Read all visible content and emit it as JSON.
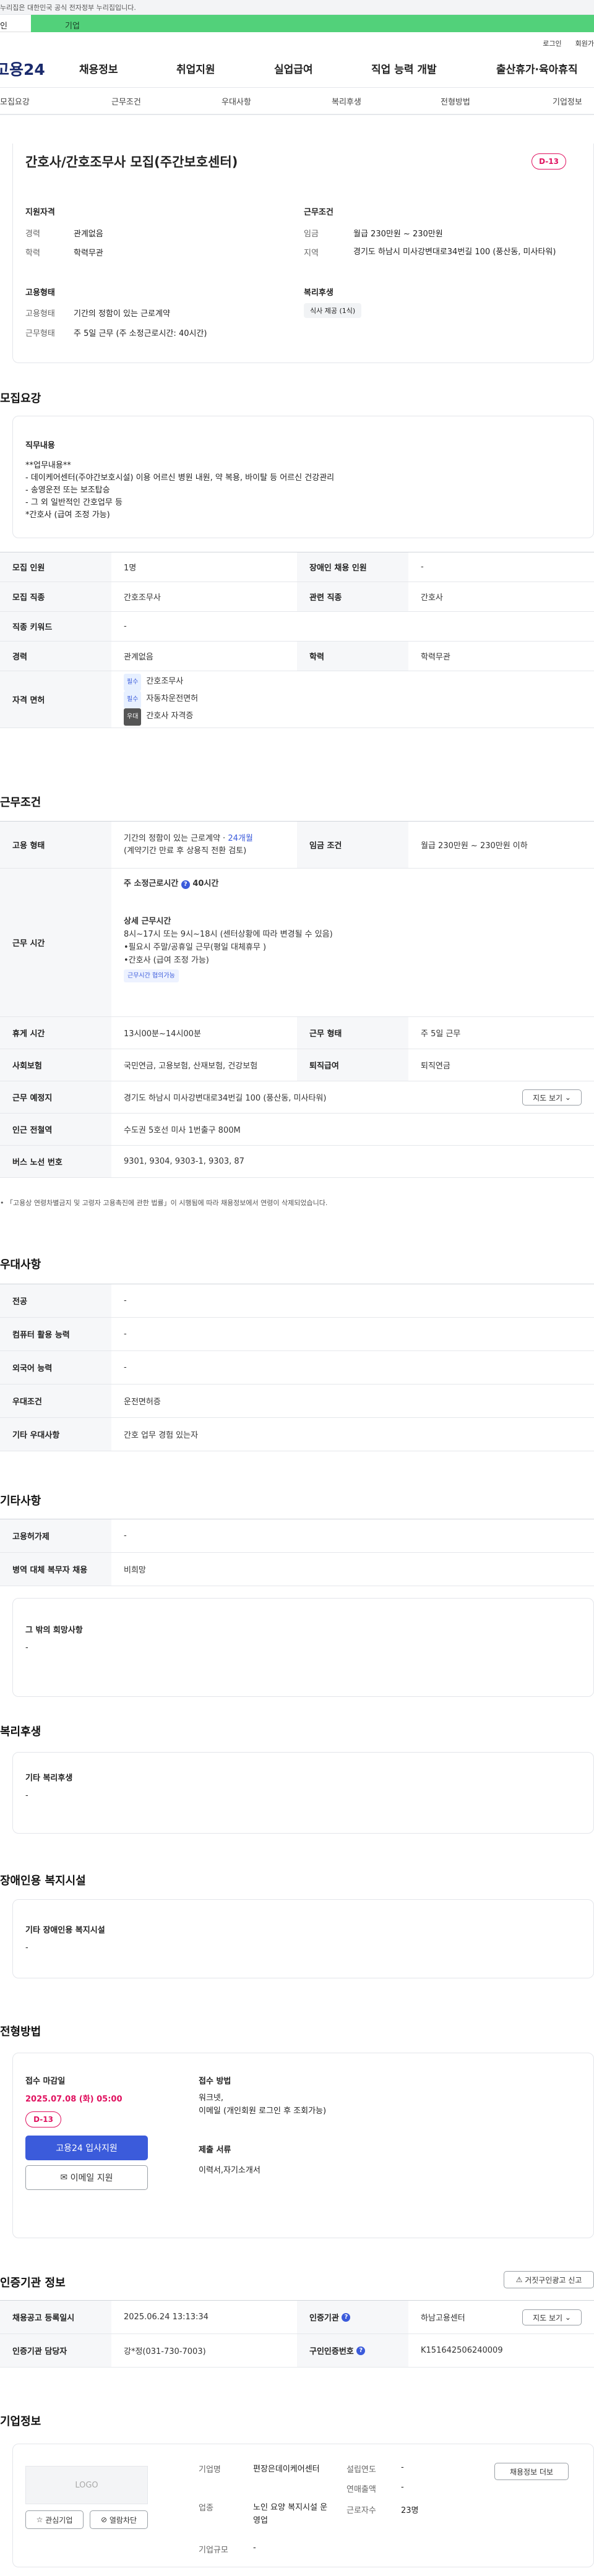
{
  "topbar": {
    "notice": "누리집은 대한민국 공식 전자정부 누리집입니다."
  },
  "user_tabs": {
    "personal": "인",
    "company": "기업"
  },
  "auth": {
    "login": "로그인",
    "signup": "회원가"
  },
  "gnb": {
    "logo": "고용24",
    "menu": [
      "채용정보",
      "취업지원",
      "실업급여",
      "직업 능력 개발",
      "출산휴가·육아휴직"
    ]
  },
  "snb": [
    "모집요강",
    "근무조건",
    "우대사항",
    "복리후생",
    "전형방법",
    "기업정보"
  ],
  "job": {
    "title": "간호사/간호조무사 모집(주간보호센터)",
    "dday": "D-13",
    "qual_head": "지원자격",
    "career_lbl": "경력",
    "career": "관계없음",
    "edu_lbl": "학력",
    "edu": "학력무관",
    "cond_head": "근무조건",
    "wage_lbl": "임금",
    "wage": "월급 230만원 ~ 230만원",
    "area_lbl": "지역",
    "area": "경기도 하남시 미사강변대로34번길 100 (풍산동, 미사타워)",
    "emp_head": "고용형태",
    "emp_type_lbl": "고용형태",
    "emp_type": "기간의 정함이 있는 근로계약",
    "work_form_lbl": "근무형태",
    "work_form": "주 5일 근무 (주 소정근로시간: 40시간)",
    "welfare_head": "복리후생",
    "welfare_tag": "식사 제공 (1식)"
  },
  "recruit": {
    "section": "모집요강",
    "duty_head": "직무내용",
    "duty_lines": [
      "**업무내용**",
      "- 데이케어센터(주야간보호시설) 이용 어르신 병원 내원, 약 복용, 바이탈 등 어르신 건강관리",
      "- 송영운전 또는 보조탑승",
      "- 그 외 일반적인 간호업무 등",
      "*간호사 (급여 조정 가능)"
    ],
    "rows": {
      "count_lbl": "모집 인원",
      "count": "1명",
      "dis_lbl": "장애인 채용 인원",
      "dis": "-",
      "job_lbl": "모집 직종",
      "job": "간호조무사",
      "rel_lbl": "관련 직종",
      "rel": "간호사",
      "kw_lbl": "직종 키워드",
      "kw": "-",
      "career_lbl": "경력",
      "career": "관계없음",
      "edu_lbl": "학력",
      "edu": "학력무관",
      "lic_lbl": "자격 면허"
    },
    "licenses": [
      {
        "tag": "필수",
        "name": "간호조무사"
      },
      {
        "tag": "필수",
        "name": "자동차운전면허"
      },
      {
        "tag": "우대",
        "name": "간호사 자격증"
      }
    ]
  },
  "conditions": {
    "section": "근무조건",
    "emp_lbl": "고용 형태",
    "emp_a": "기간의 정함이 있는 근로계약 · ",
    "emp_b": "24개월",
    "emp_c": "(계약기간 만료 후 상용직 전환 검토)",
    "wage_lbl": "임금 조건",
    "wage": "월급 230만원 ~ 230만원 이하",
    "time_lbl": "근무 시간",
    "weekly": "주 소정근로시간",
    "weekly_val": "40시간",
    "detail_head": "상세 근무시간",
    "detail_lines": [
      "8시~17시 또는 9시~18시 (센터상황에 따라 변경될 수 있음)",
      "•필요시 주말/공휴일 근무(평일 대체휴무 )",
      "•간호사 (급여 조정 가능)"
    ],
    "help_tag": "근무시간 협의가능",
    "rest_lbl": "휴게 시간",
    "rest": "13시00분~14시00분",
    "form_lbl": "근무 형태",
    "form": "주 5일 근무",
    "ins_lbl": "사회보험",
    "ins": "국민연금, 고용보험, 산재보험, 건강보험",
    "ret_lbl": "퇴직급여",
    "ret": "퇴직연금",
    "place_lbl": "근무 예정지",
    "place": "경기도 하남시 미사강변대로34번길 100 (풍산동, 미사타워)",
    "map_btn": "지도 보기",
    "subway_lbl": "인근 전철역",
    "subway": "수도권 5호선 미사 1번출구 800M",
    "bus_lbl": "버스 노선 번호",
    "bus": "9301, 9304, 9303-1, 9303, 87",
    "footnote": "「고용상 연령차별금지 및 고령자 고용촉진에 관한 법률」이 시행됨에 따라 채용정보에서 연령이 삭제되었습니다."
  },
  "prefer": {
    "section": "우대사항",
    "major_lbl": "전공",
    "major": "-",
    "pc_lbl": "컴퓨터 활용 능력",
    "pc": "-",
    "lang_lbl": "외국어 능력",
    "lang": "-",
    "cond_lbl": "우대조건",
    "cond": "운전면허증",
    "etc_lbl": "기타 우대사항",
    "etc": "간호 업무 경험 있는자"
  },
  "other": {
    "section": "기타사항",
    "gov_lbl": "고용허가제",
    "gov": "-",
    "mil_lbl": "병역 대체 복무자 채용",
    "mil": "비희망",
    "hope_head": "그 밖의 희망사항",
    "hope": "-"
  },
  "welfare": {
    "section": "복리후생",
    "head": "기타 복리후생",
    "value": "-"
  },
  "disability": {
    "section": "장애인용 복지시설",
    "head": "기타 장애인용 복지시설",
    "value": "-"
  },
  "process": {
    "section": "전형방법",
    "deadline_head": "접수 마감일",
    "deadline": "2025.07.08 (화) 05:00",
    "dday": "D-13",
    "apply_btn": "고용24 입사지원",
    "email_btn": "이메일 지원",
    "method_head": "접수 방법",
    "method_lines": [
      "워크넷,",
      "이메일 (개인회원 로그인 후 조회가능)"
    ],
    "docs_head": "제출 서류",
    "docs": "이력서,자기소개서"
  },
  "cert": {
    "section": "인증기관 정보",
    "report_btn": "거짓구인광고 신고",
    "reg_lbl": "채용공고 등록일시",
    "reg": "2025.06.24 13:13:34",
    "org_lbl": "인증기관",
    "org": "하남고용센터",
    "map_btn": "지도 보기",
    "staff_lbl": "인증기관 담당자",
    "staff": "강*정(031-730-7003)",
    "num_lbl": "구인인증번호",
    "num": "K151642506240009"
  },
  "company": {
    "section": "기업정보",
    "logo": "LOGO",
    "fav_btn": "관심기업",
    "block_btn": "열람차단",
    "name_lbl": "기업명",
    "name": "편장은데이케어센터",
    "year_lbl": "설립연도",
    "year": "-",
    "sales_lbl": "연매출액",
    "sales": "-",
    "ind_lbl": "업종",
    "ind": "노인 요양 복지시설 운영업",
    "emp_lbl": "근로자수",
    "emp": "23명",
    "size_lbl": "기업규모",
    "size": "-",
    "list_btn": "채용정보 더보"
  },
  "colors": {
    "accent": "#e0115f",
    "green": "#52d17a",
    "navy": "#1a2a6c",
    "blue": "#3b5bdb"
  }
}
